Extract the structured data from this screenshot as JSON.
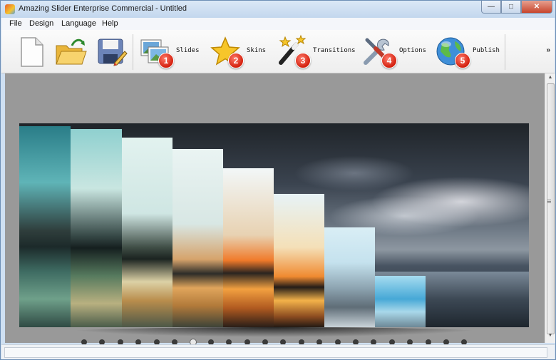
{
  "window": {
    "title": "Amazing Slider Enterprise Commercial - Untitled",
    "controls": [
      "minimize",
      "maximize",
      "close"
    ]
  },
  "menu": [
    "File",
    "Design",
    "Language",
    "Help"
  ],
  "toolbar": {
    "file_buttons": [
      {
        "name": "new-file-icon"
      },
      {
        "name": "open-folder-icon"
      },
      {
        "name": "save-icon"
      }
    ],
    "steps": [
      {
        "number": "1",
        "label": "Slides",
        "icon": "slides-icon"
      },
      {
        "number": "2",
        "label": "Skins",
        "icon": "star-icon"
      },
      {
        "number": "3",
        "label": "Transitions",
        "icon": "magic-wand-icon"
      },
      {
        "number": "4",
        "label": "Options",
        "icon": "tools-icon"
      },
      {
        "number": "5",
        "label": "Publish",
        "icon": "globe-icon"
      }
    ],
    "overflow_label": "»"
  },
  "preview": {
    "bullet_count": 22,
    "active_bullet": 6
  },
  "colors": {
    "title_bar": "#c9dbef",
    "canvas": "#999999",
    "badge": "#d3200e"
  }
}
